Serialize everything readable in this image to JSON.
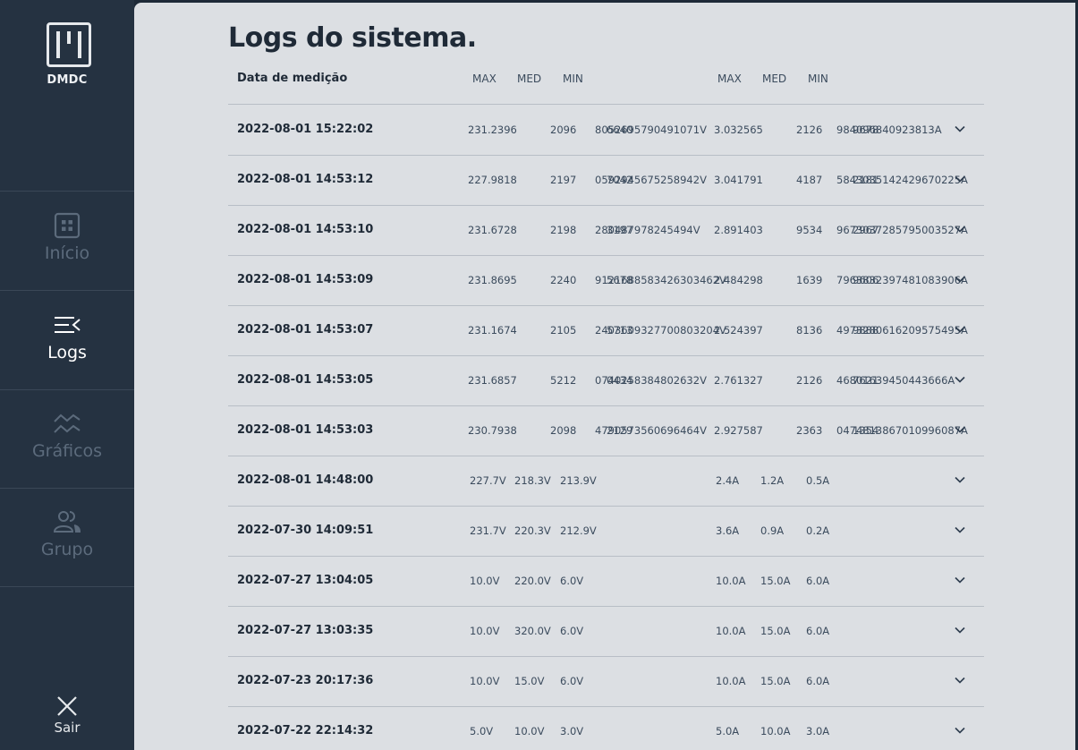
{
  "brand": {
    "name": "DMDC"
  },
  "nav": {
    "items": [
      {
        "label": "Início",
        "icon": "grid-icon",
        "active": false
      },
      {
        "label": "Logs",
        "icon": "list-collapse-icon",
        "active": true
      },
      {
        "label": "Gráficos",
        "icon": "chart-lines-icon",
        "active": false
      },
      {
        "label": "Grupo",
        "icon": "users-icon",
        "active": false
      }
    ],
    "logout_label": "Sair"
  },
  "page": {
    "title": "Logs do sistema.",
    "headers": {
      "date": "Data de medição",
      "voltage": {
        "max": "MAX",
        "med": "MED",
        "min": "MIN"
      },
      "current": {
        "max": "MAX",
        "med": "MED",
        "min": "MIN"
      }
    }
  },
  "logs": [
    {
      "date": "2022-08-01 15:22:02",
      "v_max": "231.2396",
      "v_med": "2096",
      "v_min": "6640",
      "v_rest": "8052695790491071V",
      "c_max": "3.032565",
      "c_med": "2126",
      "c_min": "9678",
      "c_rest": "984096840923813A"
    },
    {
      "date": "2022-08-01 14:53:12",
      "v_max": "227.9818",
      "v_med": "2197",
      "v_min": "7042",
      "v_rest": "0592945675258942V",
      "c_max": "3.041791",
      "c_med": "4187",
      "c_min": "2181",
      "c_rest": "5843035142429670225A"
    },
    {
      "date": "2022-08-01 14:53:10",
      "v_max": "231.6728",
      "v_med": "2198",
      "v_min": "3197",
      "v_rest": "280487978245494V",
      "c_max": "2.891403",
      "c_med": "9534",
      "c_min": "2967",
      "c_rest": "9673037285795003527A"
    },
    {
      "date": "2022-08-01 14:53:09",
      "v_max": "231.8695",
      "v_med": "2240",
      "v_min": "5678",
      "v_rest": "9121688583426303462V",
      "c_max": "2.484298",
      "c_med": "1639",
      "c_min": "9606",
      "c_rest": "7963832397481083906A"
    },
    {
      "date": "2022-08-01 14:53:07",
      "v_max": "231.1674",
      "v_med": "2105",
      "v_min": "5713",
      "v_rest": "2403609327700803204V",
      "c_max": "2.524397",
      "c_med": "8136",
      "c_min": "9888",
      "c_rest": "4973280616209575495A"
    },
    {
      "date": "2022-08-01 14:53:05",
      "v_max": "231.6857",
      "v_med": "5212",
      "v_min": "0434",
      "v_rest": "0740258384802632V",
      "c_max": "2.761327",
      "c_med": "2126",
      "c_min": "7621",
      "c_rest": "46801639450443666A"
    },
    {
      "date": "2022-08-01 14:53:03",
      "v_max": "230.7938",
      "v_med": "2098",
      "v_min": "2129",
      "v_rest": "4790573560696464V",
      "c_max": "2.927587",
      "c_med": "2363",
      "c_min": "1354",
      "c_rest": "0474813867010996087A"
    },
    {
      "date": "2022-08-01 14:48:00",
      "v_max": "227.7V",
      "v_med": "218.3V",
      "v_min": "213.9V",
      "v_rest": "",
      "c_max": "2.4A",
      "c_med": "1.2A",
      "c_min": "0.5A",
      "c_rest": ""
    },
    {
      "date": "2022-07-30 14:09:51",
      "v_max": "231.7V",
      "v_med": "220.3V",
      "v_min": "212.9V",
      "v_rest": "",
      "c_max": "3.6A",
      "c_med": "0.9A",
      "c_min": "0.2A",
      "c_rest": ""
    },
    {
      "date": "2022-07-27 13:04:05",
      "v_max": "10.0V",
      "v_med": "220.0V",
      "v_min": "6.0V",
      "v_rest": "",
      "c_max": "10.0A",
      "c_med": "15.0A",
      "c_min": "6.0A",
      "c_rest": ""
    },
    {
      "date": "2022-07-27 13:03:35",
      "v_max": "10.0V",
      "v_med": "320.0V",
      "v_min": "6.0V",
      "v_rest": "",
      "c_max": "10.0A",
      "c_med": "15.0A",
      "c_min": "6.0A",
      "c_rest": ""
    },
    {
      "date": "2022-07-23 20:17:36",
      "v_max": "10.0V",
      "v_med": "15.0V",
      "v_min": "6.0V",
      "v_rest": "",
      "c_max": "10.0A",
      "c_med": "15.0A",
      "c_min": "6.0A",
      "c_rest": ""
    },
    {
      "date": "2022-07-22 22:14:32",
      "v_max": "5.0V",
      "v_med": "10.0V",
      "v_min": "3.0V",
      "v_rest": "",
      "c_max": "5.0A",
      "c_med": "10.0A",
      "c_min": "3.0A",
      "c_rest": ""
    }
  ]
}
